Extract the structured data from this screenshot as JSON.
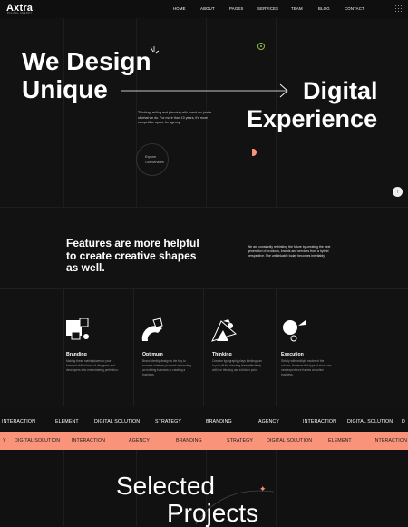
{
  "header": {
    "logo": "Axtra",
    "logo_tagline": "DIGITAL AGENCY",
    "nav": [
      "HOME",
      "ABOUT",
      "PAGES",
      "SERVICES",
      "TEAM",
      "BLOG",
      "CONTACT"
    ],
    "menu_icon": "grid-dots-icon"
  },
  "hero": {
    "title_line1": "We Design",
    "title_line2": "Unique",
    "title_right1": "Digital",
    "title_right2": "Experience",
    "paragraph": "Thinking, writing and planning with brand are just a of what we do. For more than 10 years, it's more competitive space for agency.",
    "explore_line1": "Explore",
    "explore_line2": "Our Services",
    "accent_color": "#f9947b"
  },
  "features": {
    "heading_line1": "Features are more helpful",
    "heading_line2": "to create creative shapes",
    "heading_line3": "as well.",
    "intro": "We are constantly rethinking the future by creating the next generation of products, brands and services from a hybrid perspective. The unthinkable today becomes inevitably.",
    "items": [
      {
        "title": "Branding",
        "desc": "Making these marketplaces to your branded skilled team of designers and developers who embroidering perfection."
      },
      {
        "title": "Optimum",
        "desc": "Brand identity design is the key to success whether you mark rebranding an existing business to creating a business."
      },
      {
        "title": "Thinking",
        "desc": "Creative typography plays thinking can to pull off the standing team effectively with the thinking use a thicker point."
      },
      {
        "title": "Execution",
        "desc": "Strictly with multiple modes of the colours, However this type of shots can next experience frames an online business."
      }
    ]
  },
  "marquee": {
    "row1": [
      "INTERACTION",
      "ELEMENT",
      "DIGITAL SOLUTION",
      "STRATEGY",
      "BRANDING",
      "AGENCY",
      "INTERACTION",
      "DIGITAL SOLUTION",
      "D"
    ],
    "row2": [
      "Y",
      "DIGITAL SOLUTION",
      "INTERACTION",
      "AGENCY",
      "BRANDING",
      "STRATEGY",
      "DIGITAL SOLUTION",
      "ELEMENT",
      "INTERACTION"
    ]
  },
  "projects": {
    "title_line1": "Selected",
    "title_line2": "Projects"
  }
}
